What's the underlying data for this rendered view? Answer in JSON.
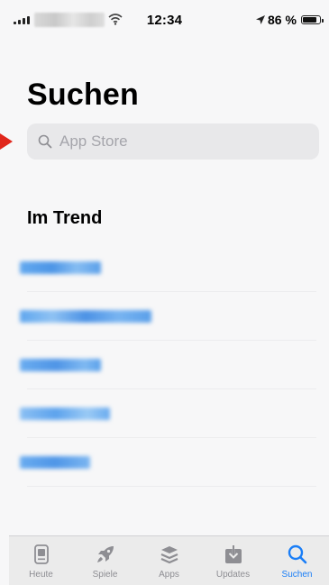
{
  "status_bar": {
    "time": "12:34",
    "battery": "86 %",
    "battery_level": 0.86
  },
  "page": {
    "title": "Suchen"
  },
  "search": {
    "placeholder": "App Store",
    "value": ""
  },
  "trending": {
    "title": "Im Trend",
    "items": [
      {
        "label": "",
        "blurred": true
      },
      {
        "label": "",
        "blurred": true
      },
      {
        "label": "",
        "blurred": true
      },
      {
        "label": "",
        "blurred": true
      },
      {
        "label": "",
        "blurred": true
      }
    ]
  },
  "tab_bar": {
    "tabs": [
      {
        "label": "Heute",
        "icon": "today-icon",
        "active": false
      },
      {
        "label": "Spiele",
        "icon": "rocket-icon",
        "active": false
      },
      {
        "label": "Apps",
        "icon": "apps-stack-icon",
        "active": false
      },
      {
        "label": "Updates",
        "icon": "updates-download-icon",
        "active": false
      },
      {
        "label": "Suchen",
        "icon": "search-icon",
        "active": true
      }
    ]
  },
  "colors": {
    "accent": "#1a7ef7",
    "inactive_tab": "#8e8e93",
    "background": "#f7f7f8",
    "search_field": "#e8e8ea",
    "annotation_arrow": "#e0261b",
    "blurred_text": "#5aa3ef"
  }
}
